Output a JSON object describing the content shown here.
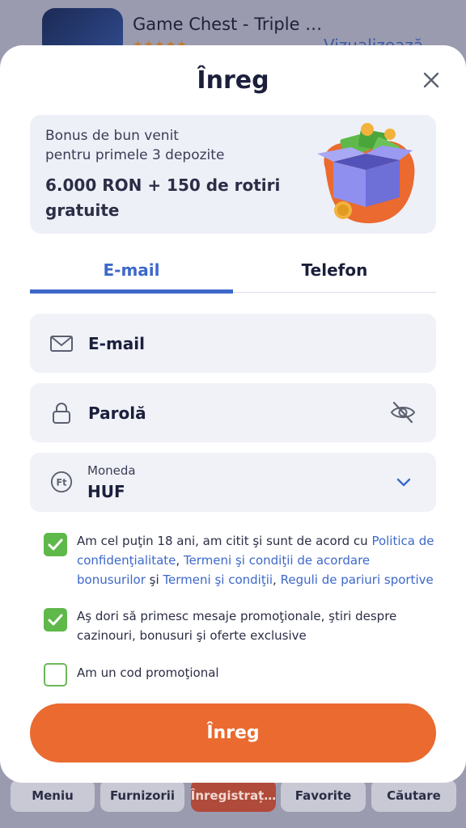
{
  "background": {
    "app_title": "Game Chest - Triple …",
    "app_stars": "★★★★★",
    "app_action": "Vizualizează"
  },
  "bottom_nav": {
    "items": [
      {
        "label": "Meniu"
      },
      {
        "label": "Furnizorii"
      },
      {
        "label": "Înregistraț…"
      },
      {
        "label": "Favorite"
      },
      {
        "label": "Căutare"
      }
    ]
  },
  "modal": {
    "title": "Înreg",
    "bonus": {
      "line1": "Bonus de bun venit",
      "line2": "pentru primele 3 depozite",
      "amount": "6.000 RON + 150 de rotiri gratuite"
    },
    "tabs": {
      "email": "E-mail",
      "phone": "Telefon",
      "active": "email"
    },
    "fields": {
      "email_placeholder": "E-mail",
      "password_placeholder": "Parolă",
      "currency_label": "Moneda",
      "currency_value": "HUF",
      "currency_icon_text": "Ft"
    },
    "consents": {
      "terms": {
        "checked": true,
        "text_1": "Am cel puţin 18 ani, am citit şi sunt de acord cu ",
        "link_privacy": "Politica de confidenţialitate",
        "sep_1": ", ",
        "link_bonus_terms": "Termeni şi condiţii de acordare bonusurilor",
        "sep_2": " şi ",
        "link_terms": "Termeni şi condiţii",
        "sep_3": ", ",
        "link_betting_rules": "Reguli de pariuri sportive"
      },
      "marketing": {
        "checked": true,
        "text": "Aş dori să primesc mesaje promoţionale, ştiri despre cazinouri, bonusuri şi oferte exclusive"
      },
      "promo_code": {
        "checked": false,
        "text": "Am un cod promoţional"
      }
    },
    "submit_label": "Înreg"
  },
  "colors": {
    "accent_blue": "#3d68c9",
    "submit_orange": "#ea6a2f",
    "check_green": "#5fb84a",
    "title_dark": "#1b1f3b"
  },
  "icons": [
    "close-icon",
    "gift-box-icon",
    "mail-icon",
    "lock-icon",
    "eye-off-icon",
    "currency-icon",
    "chevron-down-icon",
    "check-icon"
  ]
}
